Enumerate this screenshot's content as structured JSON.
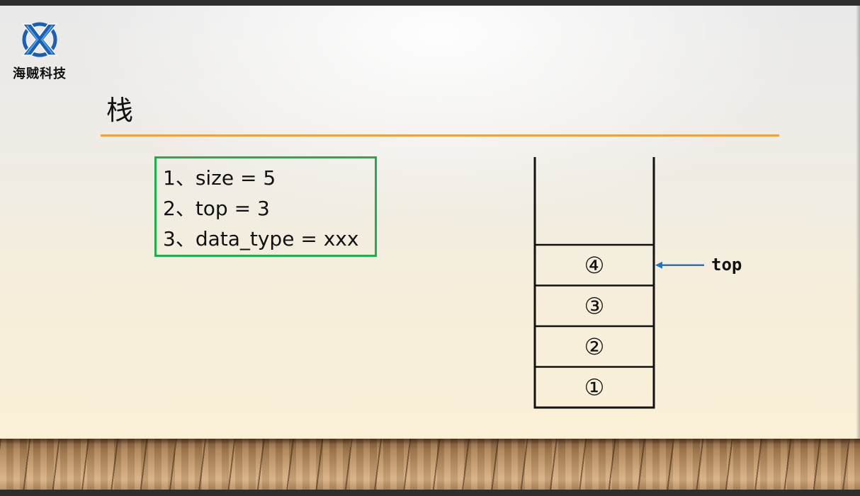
{
  "logo": {
    "icon": "x-circle-logo-icon",
    "text": "海贼科技"
  },
  "title": "栈",
  "info_box": {
    "lines": [
      "1、size = 5",
      "2、top = 3",
      "3、data_type = xxx"
    ]
  },
  "stack": {
    "capacity": 5,
    "slots": [
      "①",
      "②",
      "③",
      "④",
      ""
    ],
    "top_label": "top",
    "top_index": 3
  },
  "colors": {
    "title_rule": "#f0a040",
    "box_border": "#1fae4b",
    "arrow": "#1f77c2",
    "logo_blue": "#1d5fb0"
  }
}
